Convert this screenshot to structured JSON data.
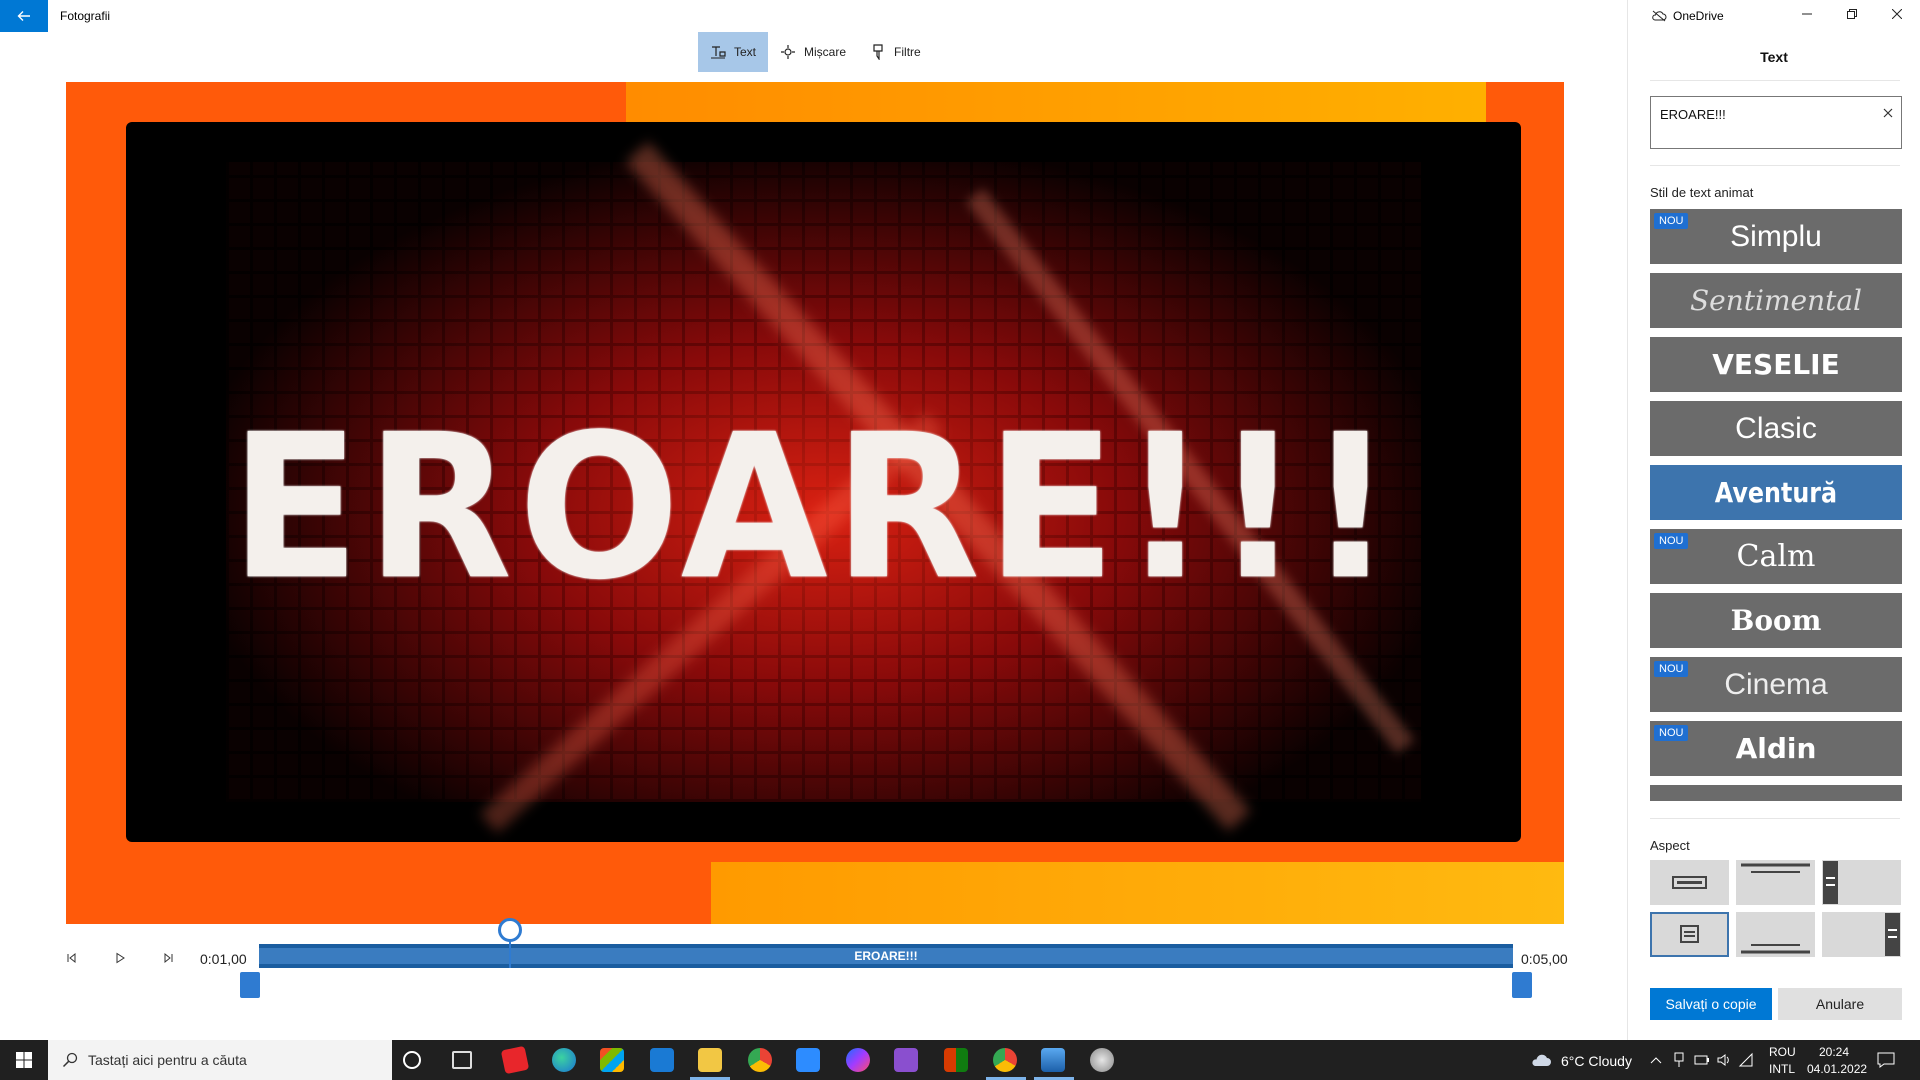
{
  "app": {
    "title": "Fotografii"
  },
  "toolbar": {
    "items": [
      {
        "label": "Text",
        "icon": "text-icon",
        "active": true
      },
      {
        "label": "Mișcare",
        "icon": "motion-icon",
        "active": false
      },
      {
        "label": "Filtre",
        "icon": "filter-icon",
        "active": false
      }
    ]
  },
  "preview": {
    "overlay_text": "EROARE!!!"
  },
  "timeline": {
    "start_time": "0:01,00",
    "end_time": "0:05,00",
    "clip_label": "EROARE!!!",
    "playhead_fraction": 0.2
  },
  "panel": {
    "onedrive_label": "OneDrive",
    "title": "Text",
    "text_value": "EROARE!!!",
    "styles_heading": "Stil de text animat",
    "styles": [
      {
        "label": "Simplu",
        "new": true,
        "selected": false
      },
      {
        "label": "Sentimental",
        "new": false,
        "selected": false
      },
      {
        "label": "VESELIE",
        "new": false,
        "selected": false
      },
      {
        "label": "Clasic",
        "new": false,
        "selected": false
      },
      {
        "label": "Aventură",
        "new": false,
        "selected": true
      },
      {
        "label": "Calm",
        "new": true,
        "selected": false
      },
      {
        "label": "Boom",
        "new": false,
        "selected": false
      },
      {
        "label": "Cinema",
        "new": true,
        "selected": false
      },
      {
        "label": "Aldin",
        "new": true,
        "selected": false
      }
    ],
    "new_badge": "NOU",
    "aspect_heading": "Aspect",
    "save_label": "Salvați o copie",
    "cancel_label": "Anulare"
  },
  "taskbar": {
    "search_placeholder": "Tastați aici pentru a căuta",
    "weather": "6°C  Cloudy",
    "lang_top": "ROU",
    "lang_bottom": "INTL",
    "time": "20:24",
    "date": "04.01.2022"
  },
  "colors": {
    "accent": "#0078d4",
    "selected_tile": "#3d74ad",
    "tile": "#6b6b6b",
    "preview_frame": "#ff5a0a"
  }
}
